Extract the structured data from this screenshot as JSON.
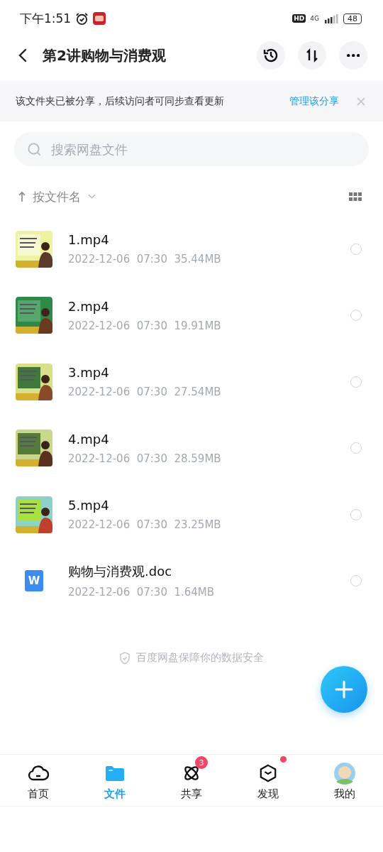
{
  "status_bar": {
    "time": "下午1:51",
    "hd": "HD",
    "network": "4G",
    "battery": "48"
  },
  "header": {
    "title": "第2讲购物与消费观"
  },
  "share_banner": {
    "text": "该文件夹已被分享，后续访问者可同步查看更新",
    "link": "管理该分享"
  },
  "search": {
    "placeholder": "搜索网盘文件"
  },
  "sort": {
    "label": "按文件名"
  },
  "files": [
    {
      "kind": "video",
      "name": "1.mp4",
      "date": "2022-12-06",
      "time": "07:30",
      "size": "35.44MB",
      "selected": false
    },
    {
      "kind": "video",
      "name": "2.mp4",
      "date": "2022-12-06",
      "time": "07:30",
      "size": "19.91MB",
      "selected": false
    },
    {
      "kind": "video",
      "name": "3.mp4",
      "date": "2022-12-06",
      "time": "07:30",
      "size": "27.54MB",
      "selected": false
    },
    {
      "kind": "video",
      "name": "4.mp4",
      "date": "2022-12-06",
      "time": "07:30",
      "size": "28.59MB",
      "selected": false
    },
    {
      "kind": "video",
      "name": "5.mp4",
      "date": "2022-12-06",
      "time": "07:30",
      "size": "23.25MB",
      "selected": false
    },
    {
      "kind": "doc",
      "icon_letter": "W",
      "name": "购物与消费观.doc",
      "date": "2022-12-06",
      "time": "07:30",
      "size": "1.64MB",
      "selected": false
    }
  ],
  "footer_note": "百度网盘保障你的数据安全",
  "nav": [
    {
      "kind": "home",
      "label": "首页",
      "selected": false
    },
    {
      "kind": "files",
      "label": "文件",
      "selected": true
    },
    {
      "kind": "share",
      "label": "共享",
      "selected": false,
      "badge": "3"
    },
    {
      "kind": "discover",
      "label": "发现",
      "selected": false,
      "dot": true
    },
    {
      "kind": "me",
      "label": "我的",
      "selected": false
    }
  ]
}
